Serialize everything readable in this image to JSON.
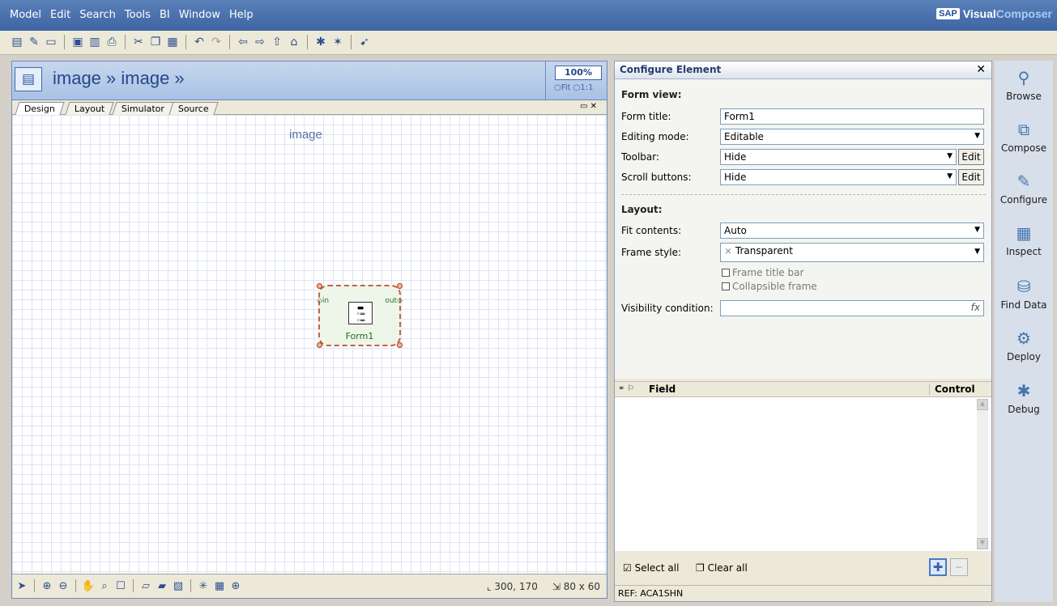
{
  "menu": [
    "Model",
    "Edit",
    "Search",
    "Tools",
    "BI",
    "Window",
    "Help"
  ],
  "brand": {
    "sap": "SAP",
    "visual": "Visual",
    "composer": "Composer"
  },
  "toolbar_icons": [
    "new-icon",
    "open-icon",
    "folder-icon",
    "save-icon",
    "save-all-icon",
    "print-icon",
    "cut-icon",
    "copy-icon",
    "paste-icon",
    "undo-icon",
    "redo-icon",
    "back-icon",
    "forward-icon",
    "up-icon",
    "home-icon",
    "run-icon",
    "deploy-icon",
    "help-pointer-icon"
  ],
  "design": {
    "title": "image » image »",
    "zoom": "100%",
    "zoom_fit": "○Fit ○1:1",
    "tabs": [
      "Design",
      "Layout",
      "Simulator",
      "Source"
    ],
    "canvas_label": "image",
    "element": {
      "in": "in",
      "out": "out",
      "label": "Form1"
    },
    "coords": "300, 170",
    "size": "80 x 60"
  },
  "configure": {
    "title": "Configure Element",
    "form_view": "Form view:",
    "form_title_label": "Form title:",
    "form_title_value": "Form1",
    "editing_mode_label": "Editing mode:",
    "editing_mode_value": "Editable",
    "toolbar_label": "Toolbar:",
    "toolbar_value": "Hide",
    "scroll_label": "Scroll buttons:",
    "scroll_value": "Hide",
    "edit": "Edit",
    "layout": "Layout:",
    "fit_label": "Fit contents:",
    "fit_value": "Auto",
    "frame_label": "Frame style:",
    "frame_value": "Transparent",
    "frame_title_bar": "Frame title bar",
    "collapsible": "Collapsible frame",
    "visibility_label": "Visibility condition:",
    "grid_field": "Field",
    "grid_control": "Control",
    "select_all": "Select all",
    "clear_all": "Clear all",
    "ref": "REF: ACA1SHN"
  },
  "tasks": [
    "Browse",
    "Compose",
    "Configure",
    "Inspect",
    "Find Data",
    "Deploy",
    "Debug"
  ]
}
